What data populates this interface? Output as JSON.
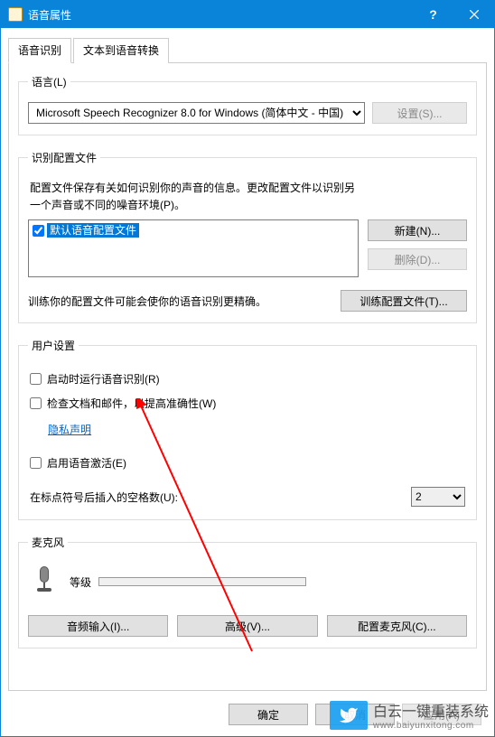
{
  "window": {
    "title": "语音属性"
  },
  "tabs": {
    "t1": "语音识别",
    "t2": "文本到语音转换"
  },
  "lang": {
    "legend": "语言(L)",
    "select_value": "Microsoft Speech Recognizer 8.0 for Windows (简体中文 - 中国)",
    "settings_btn": "设置(S)..."
  },
  "profiles": {
    "legend": "识别配置文件",
    "desc1": "配置文件保存有关如何识别你的声音的信息。更改配置文件以识别另",
    "desc2": "一个声音或不同的噪音环境(P)。",
    "item_label": "默认语音配置文件",
    "new_btn": "新建(N)...",
    "del_btn": "删除(D)...",
    "train_txt": "训练你的配置文件可能会使你的语音识别更精确。",
    "train_btn": "训练配置文件(T)..."
  },
  "user": {
    "legend": "用户设置",
    "cb_startup": "启动时运行语音识别(R)",
    "cb_review": "检查文档和邮件，以提高准确性(W)",
    "privacy_link": "隐私声明",
    "cb_activate": "启用语音激活(E)",
    "spaces_label": "在标点符号后插入的空格数(U):",
    "spaces_value": "2"
  },
  "mic": {
    "legend": "麦克风",
    "level_label": "等级",
    "audio_input_btn": "音频输入(I)...",
    "advanced_btn": "高级(V)...",
    "config_btn": "配置麦克风(C)..."
  },
  "footer": {
    "ok": "确定",
    "cancel": "取消",
    "apply": "应用(A)"
  },
  "watermark": {
    "big": "白云一键重装系统",
    "small": "www.baiyunxitong.com"
  }
}
